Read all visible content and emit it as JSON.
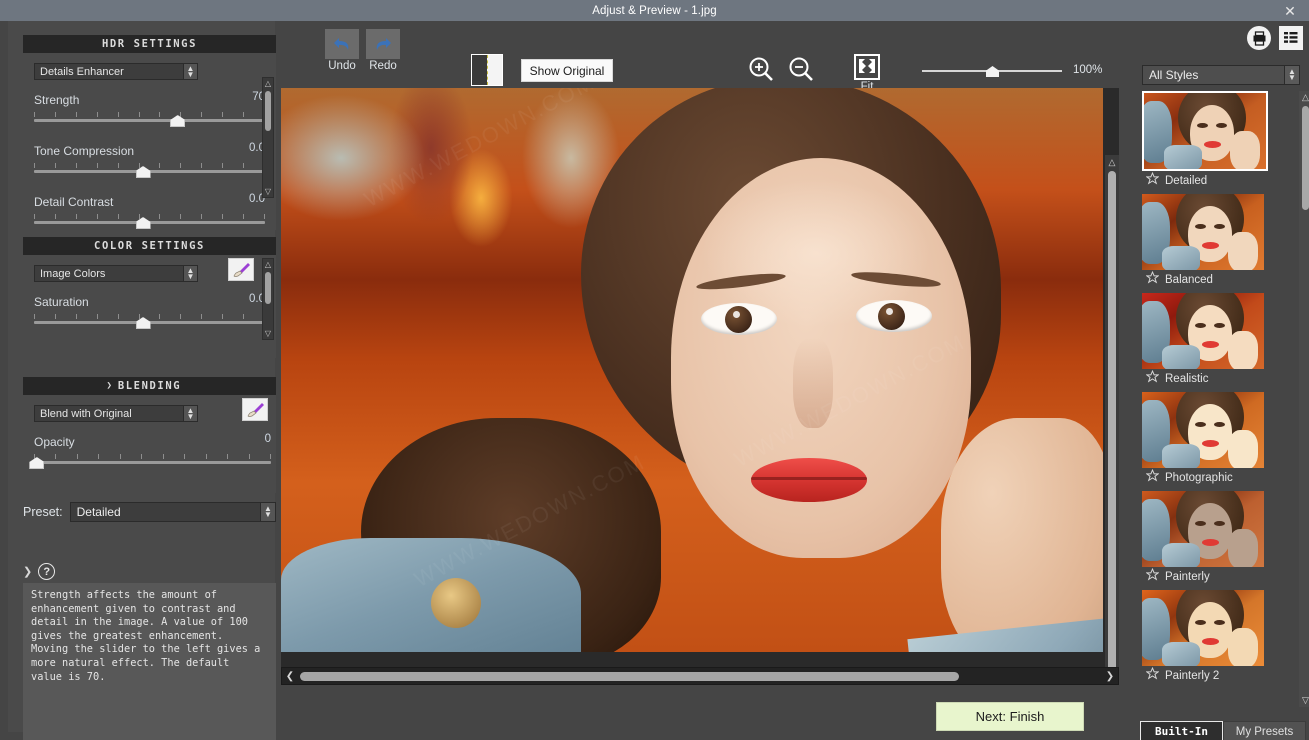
{
  "window": {
    "title": "Adjust & Preview - 1.jpg",
    "close_icon": "close-icon"
  },
  "left_panel": {
    "hdr_settings": {
      "header": "HDR SETTINGS",
      "method": "Details Enhancer",
      "sliders": [
        {
          "label": "Strength",
          "value": "70",
          "pos_pct": 62
        },
        {
          "label": "Tone Compression",
          "value": "0.0",
          "pos_pct": 47
        },
        {
          "label": "Detail Contrast",
          "value": "0.0",
          "pos_pct": 47
        }
      ]
    },
    "color_settings": {
      "header": "COLOR SETTINGS",
      "method": "Image Colors",
      "brush_icon": "paintbrush-icon",
      "sliders": [
        {
          "label": "Saturation",
          "value": "0.0",
          "pos_pct": 47
        }
      ]
    },
    "blending": {
      "header": "BLENDING",
      "caret": "chevron-down-icon",
      "method": "Blend with Original",
      "brush_icon": "paintbrush-icon",
      "sliders": [
        {
          "label": "Opacity",
          "value": "0",
          "pos_pct": 1
        }
      ]
    },
    "preset": {
      "label": "Preset:",
      "value": "Detailed"
    },
    "help": {
      "caret": "chevron-down-icon",
      "icon": "question-mark-icon",
      "text": "Strength affects the amount of\nenhancement given to contrast and\ndetail in the image. A value of 100\ngives the greatest enhancement.\nMoving the slider to the left gives a\nmore natural effect. The default\nvalue is 70."
    }
  },
  "toolbar": {
    "undo_label": "Undo",
    "undo_icon": "undo-arrow-icon",
    "redo_label": "Redo",
    "redo_icon": "redo-arrow-icon",
    "split_icon": "split-view-icon",
    "show_original_label": "Show Original",
    "zoom_in_icon": "zoom-in-icon",
    "zoom_out_icon": "zoom-out-icon",
    "fit_label": "Fit",
    "fit_icon": "fit-to-screen-icon",
    "zoom_percent": "100%",
    "zoom_slider_pos_pct": 50
  },
  "preview": {
    "next_button": "Next: Finish",
    "hscroll_left_icon": "chevron-left-icon",
    "hscroll_right_icon": "chevron-right-icon",
    "vscroll_up_icon": "chevron-up-icon",
    "vscroll_down_icon": "chevron-down-icon"
  },
  "right_panel": {
    "print_icon": "print-icon",
    "grid_icon": "grid-view-icon",
    "styles_filter": "All Styles",
    "presets": [
      {
        "name": "Detailed",
        "selected": true,
        "star_icon": "star-outline-icon"
      },
      {
        "name": "Balanced",
        "selected": false,
        "star_icon": "star-outline-icon"
      },
      {
        "name": "Realistic",
        "selected": false,
        "star_icon": "star-outline-icon"
      },
      {
        "name": "Photographic",
        "selected": false,
        "star_icon": "star-outline-icon"
      },
      {
        "name": "Painterly",
        "selected": false,
        "star_icon": "star-outline-icon"
      },
      {
        "name": "Painterly 2",
        "selected": false,
        "star_icon": "star-outline-icon"
      }
    ],
    "tabs": [
      {
        "label": "Built-In",
        "active": true
      },
      {
        "label": "My Presets",
        "active": false
      }
    ]
  },
  "colors": {
    "titlebar": "#6e7680",
    "panel_bg": "#4a4a4a",
    "section_header": "#262626",
    "accent_button": "#e8f5cd",
    "slider_track": "#9a9a9a"
  }
}
